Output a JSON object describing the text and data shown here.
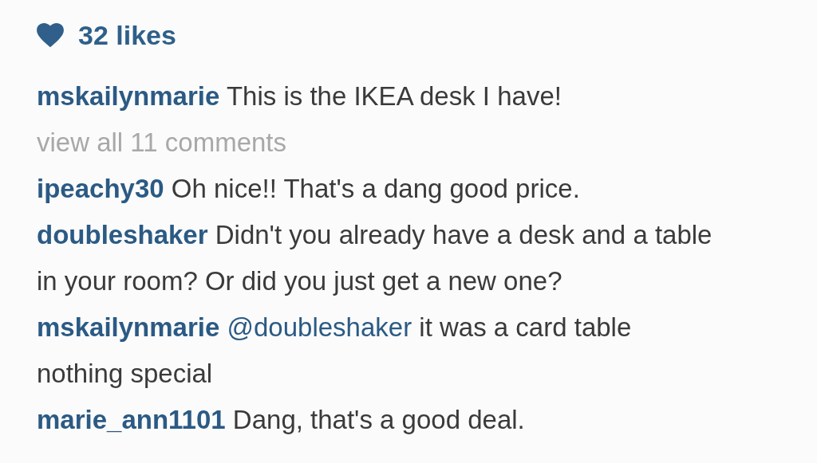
{
  "likes": {
    "count": "32 likes"
  },
  "caption": {
    "user": "mskailynmarie",
    "text": "This is the IKEA desk I have!"
  },
  "view_all": "view all 11 comments",
  "comments": [
    {
      "user": "ipeachy30",
      "text": "Oh nice!! That's a dang good price."
    },
    {
      "user": "doubleshaker",
      "text": "Didn't you already have a desk and a table in your room? Or did you just get a new one?"
    },
    {
      "user": "mskailynmarie",
      "mention": "@doubleshaker",
      "text": "it was a card table nothing special"
    },
    {
      "user": "marie_ann1101",
      "text": "Dang, that's a good deal."
    }
  ]
}
